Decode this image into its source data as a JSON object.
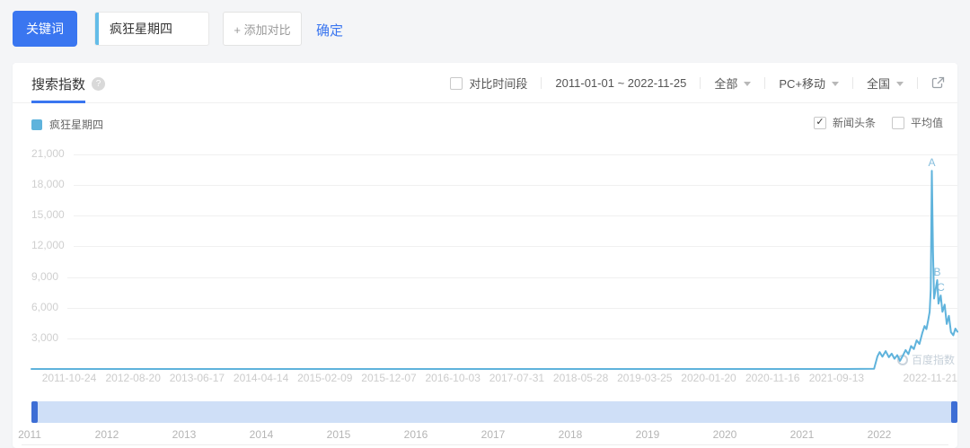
{
  "colors": {
    "accent_blue": "#3A76F0",
    "series_blue": "#5FB3DC",
    "slider_track": "#CFDFF7",
    "slider_handle": "#3D6ED5"
  },
  "toolbar": {
    "keyword_label": "关键词",
    "keyword_value": "疯狂星期四",
    "add_compare_label": "+ 添加对比",
    "confirm_label": "确定"
  },
  "panel": {
    "tab_label": "搜索指数",
    "compare_period_label": "对比时间段",
    "date_range": "2011-01-01 ~ 2022-11-25",
    "scope_dropdown": "全部",
    "device_dropdown": "PC+移动",
    "region_dropdown": "全国"
  },
  "legend": {
    "series_label": "疯狂星期四",
    "news_label": "新闻头条",
    "news_checked": true,
    "average_label": "平均值",
    "average_checked": false
  },
  "watermark_text": "百度指数",
  "chart_data": {
    "type": "line",
    "series": [
      {
        "name": "疯狂星期四",
        "color": "#5FB3DC"
      }
    ],
    "ylim": [
      0,
      21000
    ],
    "y_ticks": [
      21000,
      18000,
      15000,
      12000,
      9000,
      6000,
      3000
    ],
    "grid": true,
    "legend_position": "top-left",
    "x_range": [
      "2011-01-01",
      "2022-11-25"
    ],
    "x_tick_labels": [
      "2011-10-24",
      "2012-08-20",
      "2013-06-17",
      "2014-04-14",
      "2015-02-09",
      "2015-12-07",
      "2016-10-03",
      "2017-07-31",
      "2018-05-28",
      "2019-03-25",
      "2020-01-20",
      "2020-11-16",
      "2021-09-13",
      "2022-11-21"
    ],
    "markers": [
      {
        "label": "A",
        "x_frac": 0.9724,
        "value": 19400
      },
      {
        "label": "B",
        "x_frac": 0.9782,
        "value": 8700
      },
      {
        "label": "C",
        "x_frac": 0.982,
        "value": 7200
      }
    ],
    "points_frac_value": [
      [
        0.0,
        0
      ],
      [
        0.2,
        0
      ],
      [
        0.4,
        0
      ],
      [
        0.6,
        0
      ],
      [
        0.8,
        0
      ],
      [
        0.88,
        0
      ],
      [
        0.91,
        20
      ],
      [
        0.9137,
        1250
      ],
      [
        0.916,
        1650
      ],
      [
        0.919,
        1200
      ],
      [
        0.9225,
        1750
      ],
      [
        0.926,
        1150
      ],
      [
        0.929,
        1500
      ],
      [
        0.932,
        1000
      ],
      [
        0.935,
        1350
      ],
      [
        0.938,
        800
      ],
      [
        0.941,
        1300
      ],
      [
        0.944,
        1850
      ],
      [
        0.947,
        1450
      ],
      [
        0.95,
        2250
      ],
      [
        0.953,
        1950
      ],
      [
        0.956,
        2800
      ],
      [
        0.959,
        2450
      ],
      [
        0.962,
        3500
      ],
      [
        0.9645,
        4200
      ],
      [
        0.9665,
        3900
      ],
      [
        0.9685,
        4800
      ],
      [
        0.97,
        5600
      ],
      [
        0.9712,
        7800
      ],
      [
        0.9724,
        19400
      ],
      [
        0.9736,
        11500
      ],
      [
        0.9748,
        6900
      ],
      [
        0.9782,
        8700
      ],
      [
        0.9795,
        6400
      ],
      [
        0.982,
        7200
      ],
      [
        0.9838,
        5600
      ],
      [
        0.9862,
        6300
      ],
      [
        0.9885,
        4400
      ],
      [
        0.9908,
        5200
      ],
      [
        0.993,
        3600
      ],
      [
        0.9955,
        3300
      ],
      [
        0.9978,
        3950
      ],
      [
        1.0,
        3650
      ]
    ]
  },
  "slider": {
    "years": [
      "2011",
      "2012",
      "2013",
      "2014",
      "2015",
      "2016",
      "2017",
      "2018",
      "2019",
      "2020",
      "2021",
      "2022"
    ]
  }
}
